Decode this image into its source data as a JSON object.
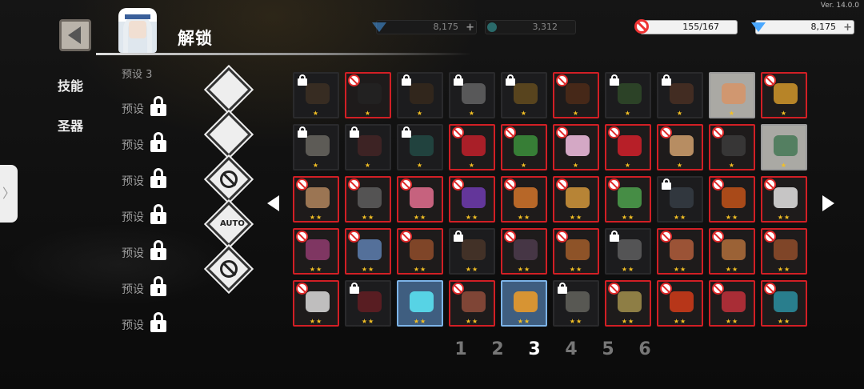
{
  "app": {
    "version": "Ver. 14.0.0"
  },
  "header": {
    "title": "解锁"
  },
  "resources": [
    {
      "value": "8,175",
      "icon": "gem-icon",
      "dim": true
    },
    {
      "value": "3,312",
      "icon": "orb-icon",
      "dim": true
    },
    {
      "value": "155/167",
      "icon": "ban-icon",
      "dim": false
    },
    {
      "value": "8,175",
      "icon": "gem-icon",
      "dim": false
    }
  ],
  "tabs": [
    {
      "label": "技能"
    },
    {
      "label": "圣器"
    }
  ],
  "presets": {
    "partial": "预设 3",
    "items": [
      "预设",
      "预设",
      "预设",
      "预设",
      "预设",
      "预设",
      "预设"
    ]
  },
  "tools": [
    {
      "name": "filter-search-icon",
      "label": ""
    },
    {
      "name": "scroll-icon",
      "label": ""
    },
    {
      "name": "ban-toggle-icon",
      "label": ""
    },
    {
      "name": "auto-icon",
      "label": "AUTO"
    },
    {
      "name": "ban-all-icon",
      "label": ""
    }
  ],
  "relics": [
    {
      "status": "locked",
      "stars": "★",
      "color": "#6b4a2a"
    },
    {
      "status": "banned",
      "stars": "★",
      "color": "#222"
    },
    {
      "status": "locked",
      "stars": "★",
      "color": "#5a3a1a"
    },
    {
      "status": "locked",
      "stars": "★",
      "color": "#c9c9c9"
    },
    {
      "status": "locked",
      "stars": "★",
      "color": "#c89020"
    },
    {
      "status": "banned",
      "stars": "★",
      "color": "#4a2a18"
    },
    {
      "status": "locked",
      "stars": "★",
      "color": "#4a8a3a"
    },
    {
      "status": "locked",
      "stars": "★",
      "color": "#8a4a2a"
    },
    {
      "status": "selected",
      "stars": "★",
      "color": "#d4956a"
    },
    {
      "status": "banned",
      "stars": "★",
      "color": "#c8902a"
    },
    {
      "status": "locked",
      "stars": "★",
      "color": "#d8d0c0"
    },
    {
      "status": "locked",
      "stars": "★",
      "color": "#7a3030"
    },
    {
      "status": "locked",
      "stars": "★",
      "color": "#2a8a7a"
    },
    {
      "status": "banned",
      "stars": "★",
      "color": "#b8202a"
    },
    {
      "status": "banned",
      "stars": "★",
      "color": "#3a8a3a"
    },
    {
      "status": "banned",
      "stars": "★",
      "color": "#e8b8d8"
    },
    {
      "status": "banned",
      "stars": "★",
      "color": "#c8202a"
    },
    {
      "status": "banned",
      "stars": "★",
      "color": "#c89a6a"
    },
    {
      "status": "banned",
      "stars": "★",
      "color": "#3a3a3a"
    },
    {
      "status": "selected",
      "stars": "★",
      "color": "#4a7a5a"
    },
    {
      "status": "banned",
      "stars": "★★",
      "color": "#a8805a"
    },
    {
      "status": "banned",
      "stars": "★★",
      "color": "#5a5a5a"
    },
    {
      "status": "banned",
      "stars": "★★",
      "color": "#d86a8a"
    },
    {
      "status": "banned",
      "stars": "★★",
      "color": "#6a3aa8"
    },
    {
      "status": "banned",
      "stars": "★★",
      "color": "#c8702a"
    },
    {
      "status": "banned",
      "stars": "★★",
      "color": "#c8903a"
    },
    {
      "status": "banned",
      "stars": "★★",
      "color": "#4a9a4a"
    },
    {
      "status": "locked",
      "stars": "★★",
      "color": "#5a6a7a"
    },
    {
      "status": "banned",
      "stars": "★★",
      "color": "#b8501a"
    },
    {
      "status": "banned",
      "stars": "★★",
      "color": "#d8d8d8"
    },
    {
      "status": "banned",
      "stars": "★★",
      "color": "#8a3a6a"
    },
    {
      "status": "banned",
      "stars": "★★",
      "color": "#5a7aa8"
    },
    {
      "status": "banned",
      "stars": "★★",
      "color": "#8a4a2a"
    },
    {
      "status": "locked",
      "stars": "★★",
      "color": "#8a5a3a"
    },
    {
      "status": "banned",
      "stars": "★★",
      "color": "#4a3a4a"
    },
    {
      "status": "banned",
      "stars": "★★",
      "color": "#9a5a2a"
    },
    {
      "status": "locked",
      "stars": "★★",
      "color": "#bcbcbc"
    },
    {
      "status": "banned",
      "stars": "★★",
      "color": "#a85a3a"
    },
    {
      "status": "banned",
      "stars": "★★",
      "color": "#a86a3a"
    },
    {
      "status": "banned",
      "stars": "★★",
      "color": "#8a4a2a"
    },
    {
      "status": "banned",
      "stars": "★★",
      "color": "#d0d0d0"
    },
    {
      "status": "locked",
      "stars": "★★",
      "color": "#c8202a"
    },
    {
      "status": "active",
      "stars": "★★",
      "color": "#5ae0f0"
    },
    {
      "status": "banned",
      "stars": "★★",
      "color": "#8a4a3a"
    },
    {
      "status": "active",
      "stars": "★★",
      "color": "#e89a2a"
    },
    {
      "status": "locked",
      "stars": "★★",
      "color": "#c8c8b8"
    },
    {
      "status": "banned",
      "stars": "★★",
      "color": "#9a8a4a"
    },
    {
      "status": "banned",
      "stars": "★★",
      "color": "#c83a1a"
    },
    {
      "status": "banned",
      "stars": "★★",
      "color": "#b8303a"
    },
    {
      "status": "banned",
      "stars": "★★",
      "color": "#2a8a9a"
    }
  ],
  "pagination": {
    "pages": [
      "1",
      "2",
      "3",
      "4",
      "5",
      "6"
    ],
    "current": "3"
  },
  "edge_tab": {
    "label": "〉"
  }
}
